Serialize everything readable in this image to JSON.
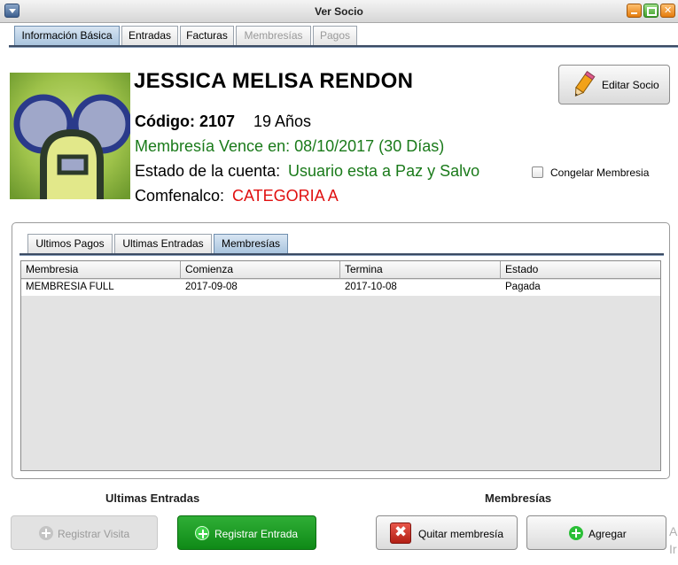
{
  "window": {
    "title": "Ver Socio"
  },
  "main_tabs": [
    {
      "label": "Información Básica",
      "state": "active"
    },
    {
      "label": "Entradas",
      "state": "normal"
    },
    {
      "label": "Facturas",
      "state": "normal"
    },
    {
      "label": "Membresías",
      "state": "disabled"
    },
    {
      "label": "Pagos",
      "state": "disabled"
    }
  ],
  "member": {
    "name": "JESSICA MELISA RENDON",
    "code_text": "Código: 2107",
    "age_text": "19 Años",
    "membership_expiry": "Membresía Vence en: 08/10/2017 (30 Días)",
    "account_status_label": "Estado de la cuenta:",
    "account_status_value": "Usuario esta a Paz y Salvo",
    "comfenalco_label": "Comfenalco:",
    "comfenalco_value": "CATEGORIA A"
  },
  "actions": {
    "edit_label": "Editar Socio",
    "freeze_label": "Congelar Membresia",
    "freeze_checked": false
  },
  "sub_tabs": [
    {
      "label": "Ultimos Pagos",
      "state": "normal"
    },
    {
      "label": "Ultimas Entradas",
      "state": "normal"
    },
    {
      "label": "Membresías",
      "state": "active"
    }
  ],
  "table": {
    "columns": [
      "Membresia",
      "Comienza",
      "Termina",
      "Estado"
    ],
    "rows": [
      [
        "MEMBRESIA FULL",
        "2017-09-08",
        "2017-10-08",
        "Pagada"
      ]
    ]
  },
  "sections": {
    "entradas_title": "Ultimas Entradas",
    "membresias_title": "Membresías"
  },
  "buttons": {
    "registrar_visita": "Registrar Visita",
    "registrar_entrada": "Registrar Entrada",
    "quitar_membresia": "Quitar membresía",
    "agregar": "Agregar"
  },
  "edge_text": [
    "A",
    "Ir"
  ],
  "colors": {
    "green_text": "#1a7a1a",
    "red_text": "#e01010",
    "primary_button": "#15911d",
    "tab_active": "#a9c4de"
  },
  "icons": {
    "edit": "pencil-icon",
    "remove": "x-box-icon",
    "add": "plus-circle-icon"
  }
}
